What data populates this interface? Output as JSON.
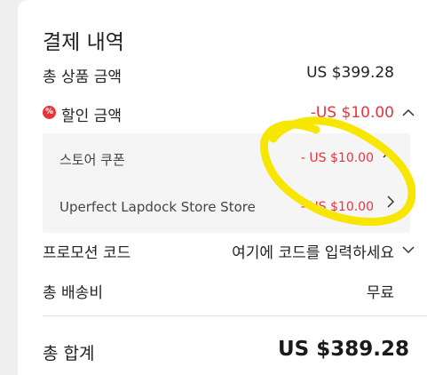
{
  "summary": {
    "title": "결제 내역",
    "subtotal_label": "총 상품 금액",
    "subtotal_value": "US $399.28",
    "discount_badge": "%",
    "discount_label": "할인 금액",
    "discount_value": "-US $10.00",
    "discount_breakdown": [
      {
        "label": "스토어 쿠폰",
        "value": "- US $10.00"
      },
      {
        "label": "Uperfect Lapdock Store Store",
        "value": "- US $10.00"
      }
    ],
    "promo_label": "프로모션 코드",
    "promo_placeholder": "여기에 코드를 입력하세요",
    "shipping_label": "총 배송비",
    "shipping_value": "무료",
    "total_label": "총 합계",
    "total_value": "US $389.28"
  },
  "colors": {
    "discount_red": "#e6353d",
    "highlight_yellow": "#f7e600",
    "panel_gray": "#f5f5f5"
  },
  "icons": {
    "discount_icon": "percent-badge-icon",
    "discount_toggle": "chevron-up-icon",
    "coupon_toggle": "chevron-up-icon",
    "store_link": "chevron-right-icon",
    "promo_toggle": "chevron-down-icon"
  }
}
